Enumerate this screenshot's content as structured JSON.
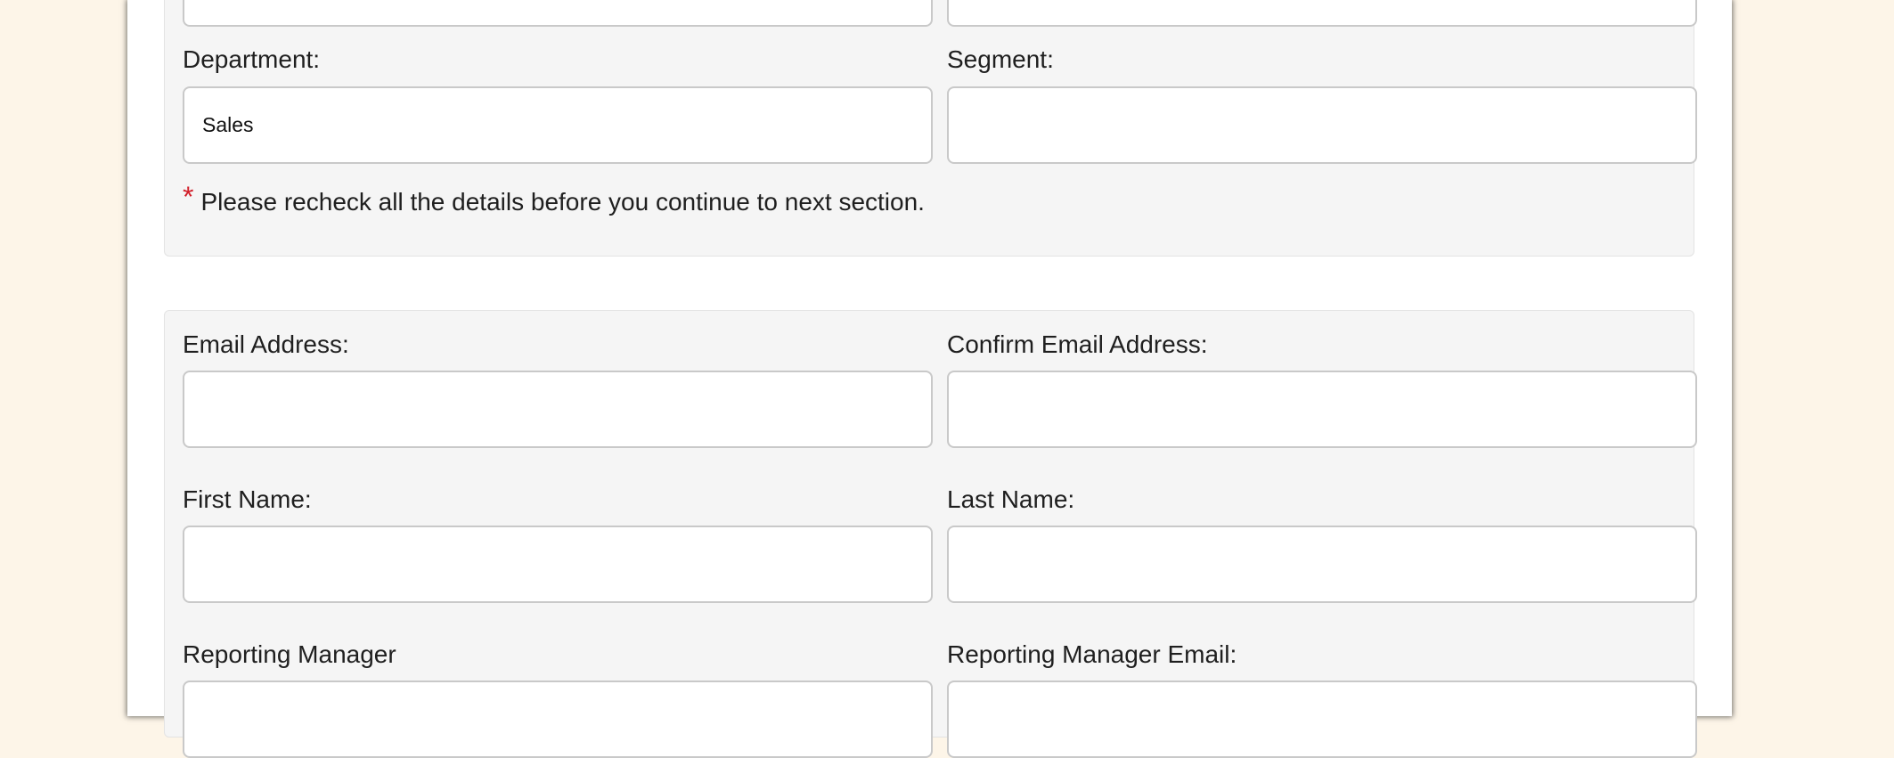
{
  "section_1": {
    "department_label": "Department:",
    "department_value": "Sales",
    "segment_label": "Segment:",
    "segment_value": "",
    "note_marker": "*",
    "note_text": "Please recheck all the details before you continue to next section."
  },
  "section_2": {
    "email_label": "Email Address:",
    "confirm_email_label": "Confirm Email Address:",
    "first_name_label": "First Name:",
    "last_name_label": "Last Name:",
    "reporting_manager_label": "Reporting Manager",
    "reporting_manager_email_label": "Reporting Manager Email:"
  },
  "colors": {
    "page_background": "#fdf5e8",
    "panel_background": "#f5f5f5",
    "required_marker": "#d21f2a"
  }
}
